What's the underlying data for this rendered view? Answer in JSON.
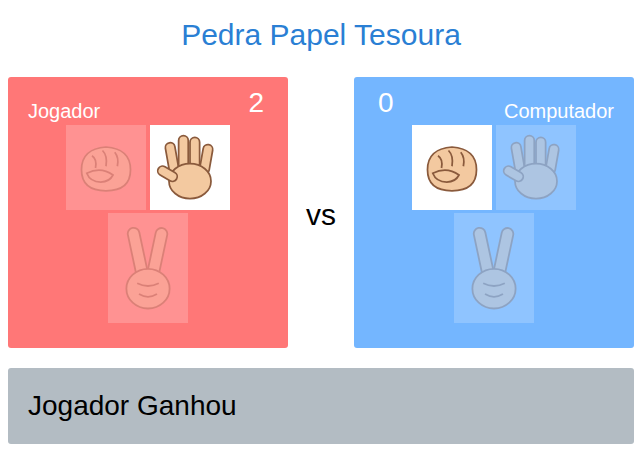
{
  "title": "Pedra Papel Tesoura",
  "player": {
    "label": "Jogador",
    "score": "2",
    "choices": [
      {
        "kind": "rock",
        "selected": false
      },
      {
        "kind": "paper",
        "selected": true
      },
      {
        "kind": "scissors",
        "selected": false
      }
    ]
  },
  "vs": "vs",
  "computer": {
    "label": "Computador",
    "score": "0",
    "choices": [
      {
        "kind": "rock",
        "selected": true
      },
      {
        "kind": "paper",
        "selected": false
      },
      {
        "kind": "scissors",
        "selected": false
      }
    ]
  },
  "result": "Jogador Ganhou"
}
